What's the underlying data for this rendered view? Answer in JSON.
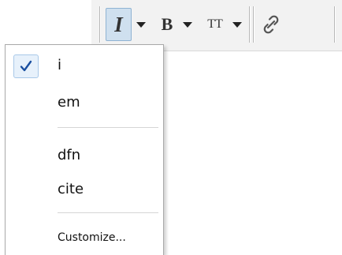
{
  "toolbar": {
    "italic_glyph": "I",
    "bold_glyph": "B",
    "teletype_glyph": "TT",
    "italic_pressed": true
  },
  "menu": {
    "items": [
      {
        "label": "i",
        "checked": true
      },
      {
        "label": "em",
        "checked": false
      },
      {
        "label": "dfn",
        "checked": false
      },
      {
        "label": "cite",
        "checked": false
      },
      {
        "label": "Customize...",
        "checked": false
      }
    ]
  },
  "colors": {
    "toolbar_bg": "#f2f2f2",
    "pressed_bg": "#cfe0ef",
    "check_color": "#1a4fa0",
    "menu_border": "#a9a9a9"
  },
  "icons": {
    "check": "checkmark-icon",
    "link": "link-icon",
    "dropdown": "caret-down-icon"
  }
}
